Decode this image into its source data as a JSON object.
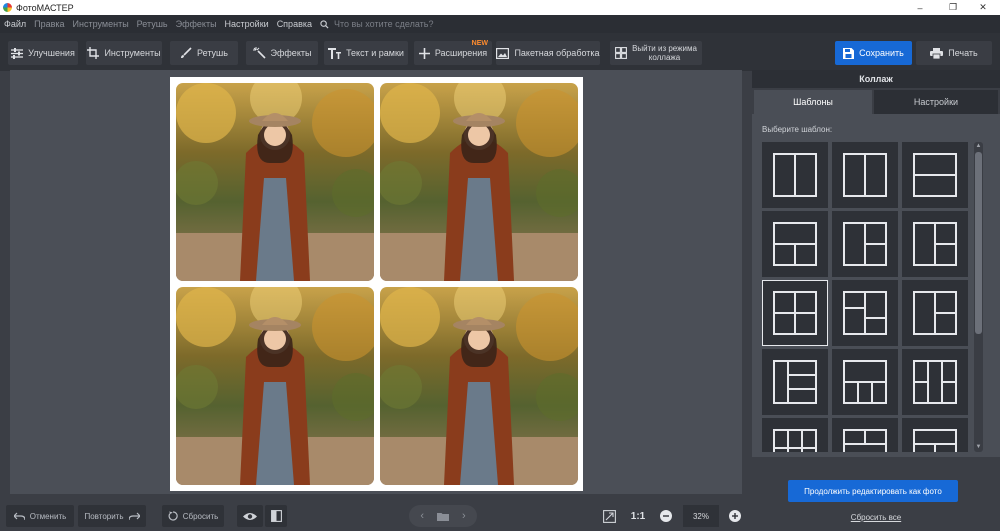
{
  "app": {
    "title": "ФотоМАСТЕР"
  },
  "menu": {
    "items": [
      "Файл",
      "Правка",
      "Инструменты",
      "Ретушь",
      "Эффекты",
      "Настройки",
      "Справка"
    ],
    "search_placeholder": "Что вы хотите сделать?"
  },
  "toolbar": {
    "enhance": "Улучшения",
    "tools": "Инструменты",
    "retouch": "Ретушь",
    "effects": "Эффекты",
    "text": "Текст и рамки",
    "extensions": "Расширения",
    "new_badge": "NEW",
    "batch": "Пакетная обработка",
    "exit_collage_line1": "Выйти из режима",
    "exit_collage_line2": "коллажа",
    "save": "Сохранить",
    "print": "Печать"
  },
  "panel": {
    "title": "Коллаж",
    "tabs": [
      "Шаблоны",
      "Настройки"
    ],
    "choose_label": "Выберите шаблон:",
    "continue_button": "Продолжить редактировать как фото",
    "reset_all": "Сбросить все",
    "selected_template_index": 6
  },
  "bottom": {
    "undo": "Отменить",
    "redo": "Повторить",
    "reset": "Сбросить",
    "actual_size": "1:1",
    "zoom": "32%"
  },
  "colors": {
    "accent": "#1769d6",
    "new_badge": "#ff8c2e",
    "panel_bg": "#4a4e56",
    "toolbar_bg": "#2f3238"
  }
}
